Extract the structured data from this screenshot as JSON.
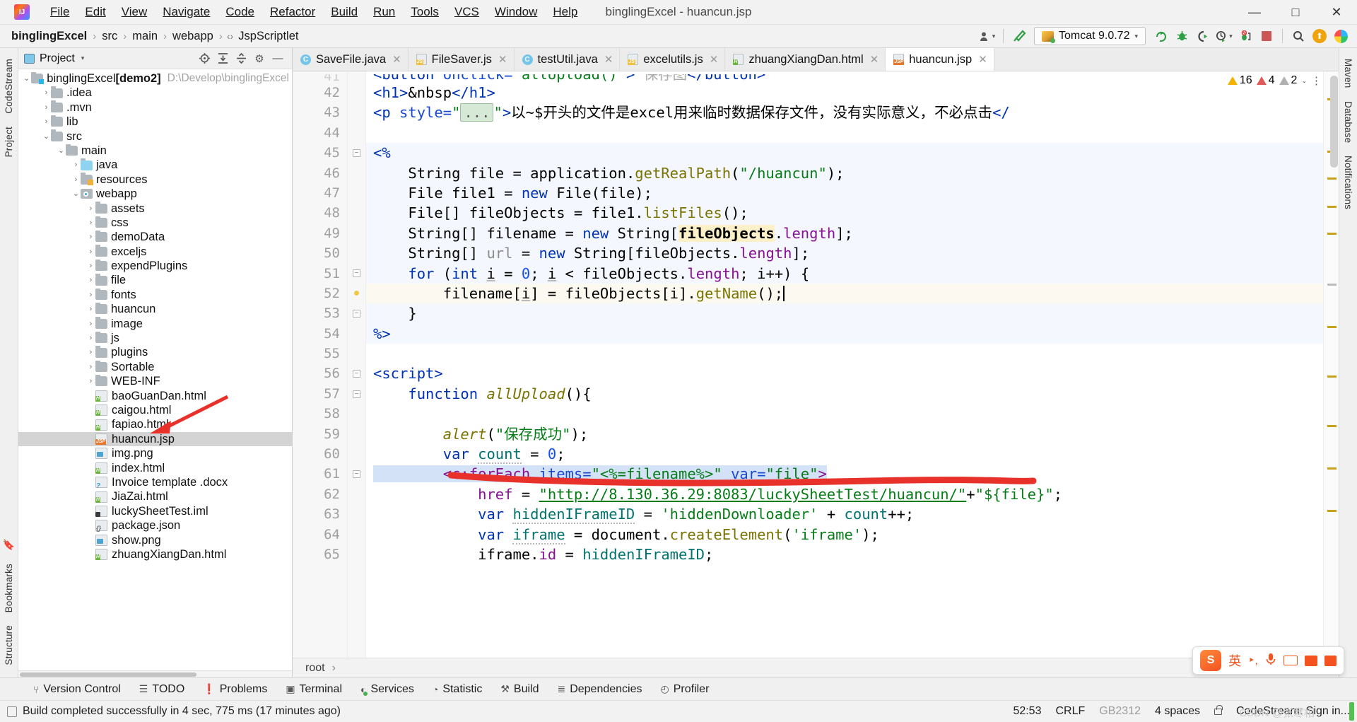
{
  "window": {
    "title": "binglingExcel - huancun.jsp",
    "minimize": "—",
    "maximize": "□",
    "close": "✕"
  },
  "menubar": {
    "items": [
      "File",
      "Edit",
      "View",
      "Navigate",
      "Code",
      "Refactor",
      "Build",
      "Run",
      "Tools",
      "VCS",
      "Window",
      "Help"
    ]
  },
  "breadcrumb": {
    "items": [
      "binglingExcel",
      "src",
      "main",
      "webapp",
      "JspScriptlet"
    ],
    "separator": "›",
    "scriptlet_icon": "‹›"
  },
  "run_toolbar": {
    "config_name": "Tomcat 9.0.72",
    "dropdown_caret": "▾",
    "icons": [
      "user-settings-icon",
      "hammer-build-icon",
      "run-icon",
      "debug-icon",
      "run-with-coverage-icon",
      "profile-icon",
      "attach-debugger-icon",
      "stop-icon",
      "search-everywhere-icon",
      "update-icon",
      "ide-ball-icon"
    ]
  },
  "left_rail": {
    "items": [
      "CodeStream",
      "Project",
      "Bookmarks",
      "Structure"
    ]
  },
  "right_rail": {
    "items": [
      "Maven",
      "Database",
      "Notifications"
    ]
  },
  "project_panel": {
    "title": "Project",
    "caret": "▾",
    "actions": [
      "locate-icon",
      "expand-all-icon",
      "collapse-all-icon",
      "settings-icon",
      "hide-icon"
    ],
    "tree": [
      {
        "depth": 0,
        "arrow": "⌄",
        "icon": "folder-module",
        "label": "binglingExcel",
        "bold_suffix": "[demo2]",
        "path": "D:\\Develop\\binglingExcel"
      },
      {
        "depth": 1,
        "arrow": "›",
        "icon": "folder",
        "label": ".idea"
      },
      {
        "depth": 1,
        "arrow": "›",
        "icon": "folder",
        "label": ".mvn"
      },
      {
        "depth": 1,
        "arrow": "›",
        "icon": "folder",
        "label": "lib"
      },
      {
        "depth": 1,
        "arrow": "⌄",
        "icon": "folder",
        "label": "src"
      },
      {
        "depth": 2,
        "arrow": "⌄",
        "icon": "folder",
        "label": "main"
      },
      {
        "depth": 3,
        "arrow": "›",
        "icon": "folder-source",
        "label": "java"
      },
      {
        "depth": 3,
        "arrow": "›",
        "icon": "folder-resources",
        "label": "resources"
      },
      {
        "depth": 3,
        "arrow": "⌄",
        "icon": "folder-webapp",
        "label": "webapp"
      },
      {
        "depth": 4,
        "arrow": "›",
        "icon": "folder",
        "label": "assets"
      },
      {
        "depth": 4,
        "arrow": "›",
        "icon": "folder",
        "label": "css"
      },
      {
        "depth": 4,
        "arrow": "›",
        "icon": "folder",
        "label": "demoData"
      },
      {
        "depth": 4,
        "arrow": "›",
        "icon": "folder",
        "label": "exceljs"
      },
      {
        "depth": 4,
        "arrow": "›",
        "icon": "folder",
        "label": "expendPlugins"
      },
      {
        "depth": 4,
        "arrow": "›",
        "icon": "folder",
        "label": "file"
      },
      {
        "depth": 4,
        "arrow": "›",
        "icon": "folder",
        "label": "fonts"
      },
      {
        "depth": 4,
        "arrow": "›",
        "icon": "folder",
        "label": "huancun"
      },
      {
        "depth": 4,
        "arrow": "›",
        "icon": "folder",
        "label": "image"
      },
      {
        "depth": 4,
        "arrow": "›",
        "icon": "folder",
        "label": "js"
      },
      {
        "depth": 4,
        "arrow": "›",
        "icon": "folder",
        "label": "plugins"
      },
      {
        "depth": 4,
        "arrow": "›",
        "icon": "folder",
        "label": "Sortable"
      },
      {
        "depth": 4,
        "arrow": "›",
        "icon": "folder",
        "label": "WEB-INF"
      },
      {
        "depth": 4,
        "arrow": "",
        "icon": "file-html",
        "label": "baoGuanDan.html"
      },
      {
        "depth": 4,
        "arrow": "",
        "icon": "file-html",
        "label": "caigou.html"
      },
      {
        "depth": 4,
        "arrow": "",
        "icon": "file-html",
        "label": "fapiao.html"
      },
      {
        "depth": 4,
        "arrow": "",
        "icon": "file-jsp",
        "label": "huancun.jsp",
        "selected": true
      },
      {
        "depth": 4,
        "arrow": "",
        "icon": "file-png",
        "label": "img.png"
      },
      {
        "depth": 4,
        "arrow": "",
        "icon": "file-html",
        "label": "index.html"
      },
      {
        "depth": 4,
        "arrow": "",
        "icon": "file-unknown",
        "label": "Invoice template .docx"
      },
      {
        "depth": 4,
        "arrow": "",
        "icon": "file-html",
        "label": "JiaZai.html"
      },
      {
        "depth": 4,
        "arrow": "",
        "icon": "file-iml",
        "label": "luckySheetTest.iml"
      },
      {
        "depth": 4,
        "arrow": "",
        "icon": "file-json",
        "label": "package.json"
      },
      {
        "depth": 4,
        "arrow": "",
        "icon": "file-png",
        "label": "show.png"
      },
      {
        "depth": 4,
        "arrow": "",
        "icon": "file-html",
        "label": "zhuangXiangDan.html"
      }
    ]
  },
  "editor_tabs": [
    {
      "label": "SaveFile.java",
      "icon": "java-class-icon",
      "active": false
    },
    {
      "label": "FileSaver.js",
      "icon": "js-file-icon",
      "active": false
    },
    {
      "label": "testUtil.java",
      "icon": "java-class-icon",
      "active": false
    },
    {
      "label": "excelutils.js",
      "icon": "js-file-icon",
      "active": false
    },
    {
      "label": "zhuangXiangDan.html",
      "icon": "html-file-icon",
      "active": false
    },
    {
      "label": "huancun.jsp",
      "icon": "jsp-file-icon",
      "active": true
    }
  ],
  "inspection_widget": {
    "warnings": "16",
    "errors": "4",
    "weak": "2",
    "chevron": "⌄",
    "menu": "⋮"
  },
  "editor": {
    "first_line": 41,
    "cursor_line": 52,
    "lines": [
      {
        "n": 41,
        "partial": true
      },
      {
        "n": 42
      },
      {
        "n": 43
      },
      {
        "n": 44
      },
      {
        "n": 45,
        "fold": true,
        "hl": true
      },
      {
        "n": 46,
        "hl": true
      },
      {
        "n": 47,
        "hl": true
      },
      {
        "n": 48,
        "hl": true
      },
      {
        "n": 49,
        "hl": true
      },
      {
        "n": 50,
        "hl": true
      },
      {
        "n": 51,
        "fold": true,
        "hl": true
      },
      {
        "n": 52,
        "bulb": true,
        "cursor": true
      },
      {
        "n": 53,
        "fold": true,
        "hl": true
      },
      {
        "n": 54,
        "hl": true
      },
      {
        "n": 55
      },
      {
        "n": 56,
        "fold": true
      },
      {
        "n": 57,
        "fold": true
      },
      {
        "n": 58
      },
      {
        "n": 59
      },
      {
        "n": 60
      },
      {
        "n": 61,
        "fold": true
      },
      {
        "n": 62
      },
      {
        "n": 63
      },
      {
        "n": 64
      },
      {
        "n": 65
      }
    ],
    "code_text": {
      "l41": "<button onclick=\"allUpload()\"> 保存图</button>",
      "l42": "<h1>&nbsp</h1>",
      "l43_a": "<p style=\"",
      "l43_ellipsis": "...",
      "l43_b": "\">以~$开头的文件是excel用来临时数据保存文件，没有实际意义，不必点击<",
      "l45": "<%",
      "l46": "String file = application.getRealPath(\"/huancun\");",
      "l47": "File file1 = new File(file);",
      "l48": "File[] fileObjects = file1.listFiles();",
      "l49": "String[] filename = new String[fileObjects.length];",
      "l50": "String[] url = new String[fileObjects.length];",
      "l51": "for (int i = 0; i < fileObjects.length; i++) {",
      "l52": "filename[i] = fileObjects[i].getName();",
      "l53": "}",
      "l54": "%>",
      "l56": "<script>",
      "l57": "function allUpload(){",
      "l59": "alert(\"保存成功\");",
      "l60": "var count = 0;",
      "l61": "<c:forEach items=\"<%=filename%>\" var=\"file\">",
      "l62": "href = \"http://8.130.36.29:8083/luckySheetTest/huancun/\"+\"${file}\";",
      "l63": "var hiddenIFrameID = 'hiddenDownloader' + count++;",
      "l64": "var iframe = document.createElement('iframe');",
      "l65": "iframe.id = hiddenIFrameID;"
    }
  },
  "editor_breadcrumb": {
    "root": "root",
    "sep": "›"
  },
  "ime_bar": {
    "logo": "S",
    "lang": "英",
    "items": [
      "sogou-logo",
      "english-mode",
      "voice-icon",
      "mic-icon",
      "keyboard-icon",
      "toolbox-icon",
      "apps-icon"
    ]
  },
  "bottom_tools": [
    {
      "label": "Version Control",
      "icon": "branch-icon"
    },
    {
      "label": "TODO",
      "icon": "list-icon"
    },
    {
      "label": "Problems",
      "icon": "problems-icon"
    },
    {
      "label": "Terminal",
      "icon": "terminal-icon"
    },
    {
      "label": "Services",
      "icon": "services-icon",
      "badge": true
    },
    {
      "label": "Statistic",
      "icon": "statistic-icon"
    },
    {
      "label": "Build",
      "icon": "build-icon"
    },
    {
      "label": "Dependencies",
      "icon": "dependencies-icon"
    },
    {
      "label": "Profiler",
      "icon": "profiler-icon"
    }
  ],
  "statusbar": {
    "message": "Build completed successfully in 4 sec, 775 ms (17 minutes ago)",
    "caret_position": "52:53",
    "line_separator": "CRLF",
    "encoding": "GB2312",
    "indent": "4 spaces",
    "lock_icon": "read-only-lock-icon",
    "codestream": "CodeStream: Sign in...",
    "watermark": "CSDN @张寒相"
  },
  "colors": {
    "accent_blue": "#0033b3",
    "string_green": "#067d17",
    "field_purple": "#871094",
    "annotation_red": "#e8312a",
    "selected_row": "#d4d4d4",
    "highlight_yellow": "#fbf0c8"
  }
}
